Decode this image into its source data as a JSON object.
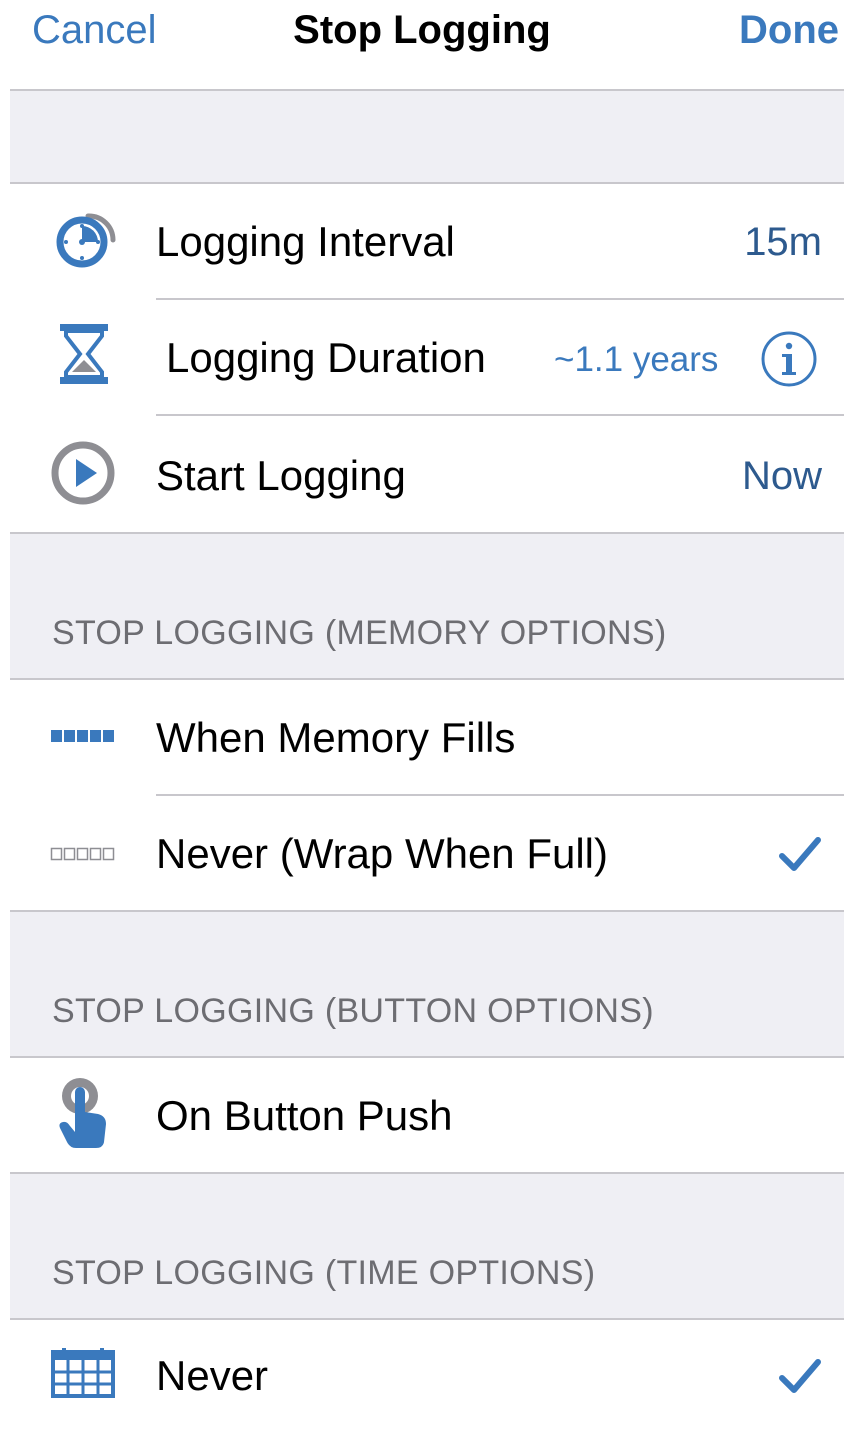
{
  "navbar": {
    "cancel": "Cancel",
    "title": "Stop Logging",
    "done": "Done"
  },
  "logging": {
    "interval": {
      "label": "Logging Interval",
      "value": "15m",
      "icon": "clock-interval-icon"
    },
    "duration": {
      "label": "Logging Duration",
      "value": "~1.1 years",
      "icon": "hourglass-icon"
    },
    "start": {
      "label": "Start Logging",
      "value": "Now",
      "icon": "play-icon"
    }
  },
  "memory_options": {
    "header": "STOP LOGGING (MEMORY OPTIONS)",
    "items": [
      {
        "label": "When Memory Fills",
        "icon": "memory-full-icon",
        "selected": false
      },
      {
        "label": "Never (Wrap When Full)",
        "icon": "memory-wrap-icon",
        "selected": true
      }
    ]
  },
  "button_options": {
    "header": "STOP LOGGING (BUTTON OPTIONS)",
    "items": [
      {
        "label": "On Button Push",
        "icon": "button-push-icon",
        "selected": false
      }
    ]
  },
  "time_options": {
    "header": "STOP LOGGING (TIME OPTIONS)",
    "items": [
      {
        "label": "Never",
        "icon": "calendar-icon",
        "selected": true
      }
    ]
  },
  "colors": {
    "accent": "#3a79bd",
    "value_text": "#2d5a8e",
    "group_bg": "#efeff4",
    "separator": "#c8c7cc",
    "icon_gray": "#8e8e93"
  }
}
